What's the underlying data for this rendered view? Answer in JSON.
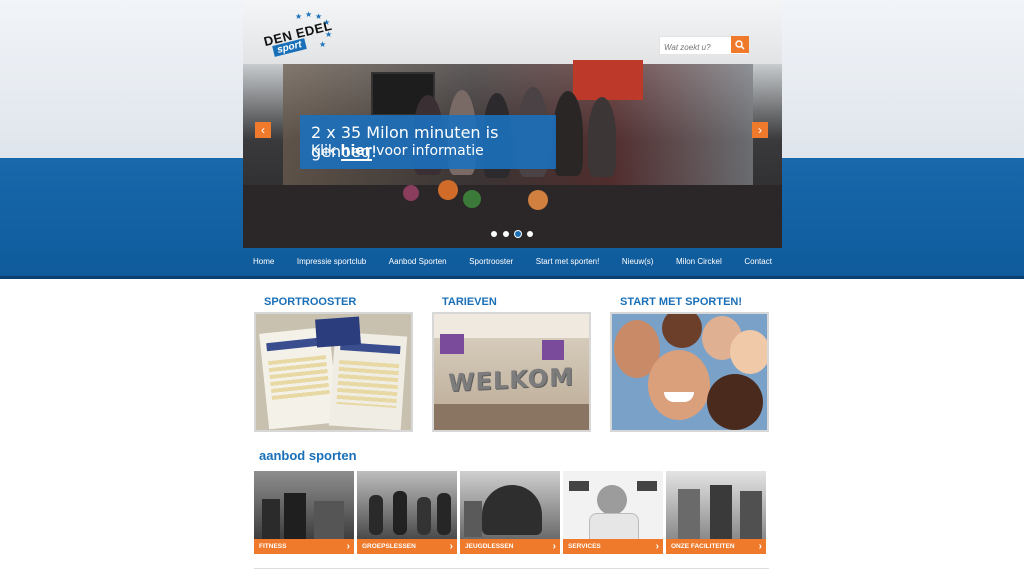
{
  "logo": {
    "line1": "DEN EDEL",
    "line2": "sport"
  },
  "search": {
    "placeholder": "Wat zoekt u?",
    "button_icon": "search-icon"
  },
  "hero": {
    "caption_line1": "2 x 35 Milon minuten is genoeg!",
    "caption_prefix": "Klik ",
    "caption_link": "hier",
    "caption_suffix": " voor informatie",
    "prev_icon": "chevron-left-icon",
    "next_icon": "chevron-right-icon",
    "slide_count": 4,
    "active_slide": 3
  },
  "nav": {
    "items": [
      "Home",
      "Impressie sportclub",
      "Aanbod Sporten",
      "Sportrooster",
      "Start met sporten!",
      "Nieuw(s)",
      "Milon Circkel",
      "Contact"
    ]
  },
  "features": [
    {
      "title": "SPORTROOSTER"
    },
    {
      "title": "TARIEVEN",
      "image_text": "WELKOM"
    },
    {
      "title": "START MET SPORTEN!"
    }
  ],
  "aanbod": {
    "title": "aanbod sporten",
    "tiles": [
      "FITNESS",
      "GROEPSLESSEN",
      "JEUGDLESSEN",
      "SERVICES",
      "ONZE FACILITEITEN"
    ]
  },
  "colors": {
    "brand_blue": "#1970b8",
    "accent_orange": "#f07a2b",
    "band_blue": "#1868ab"
  }
}
